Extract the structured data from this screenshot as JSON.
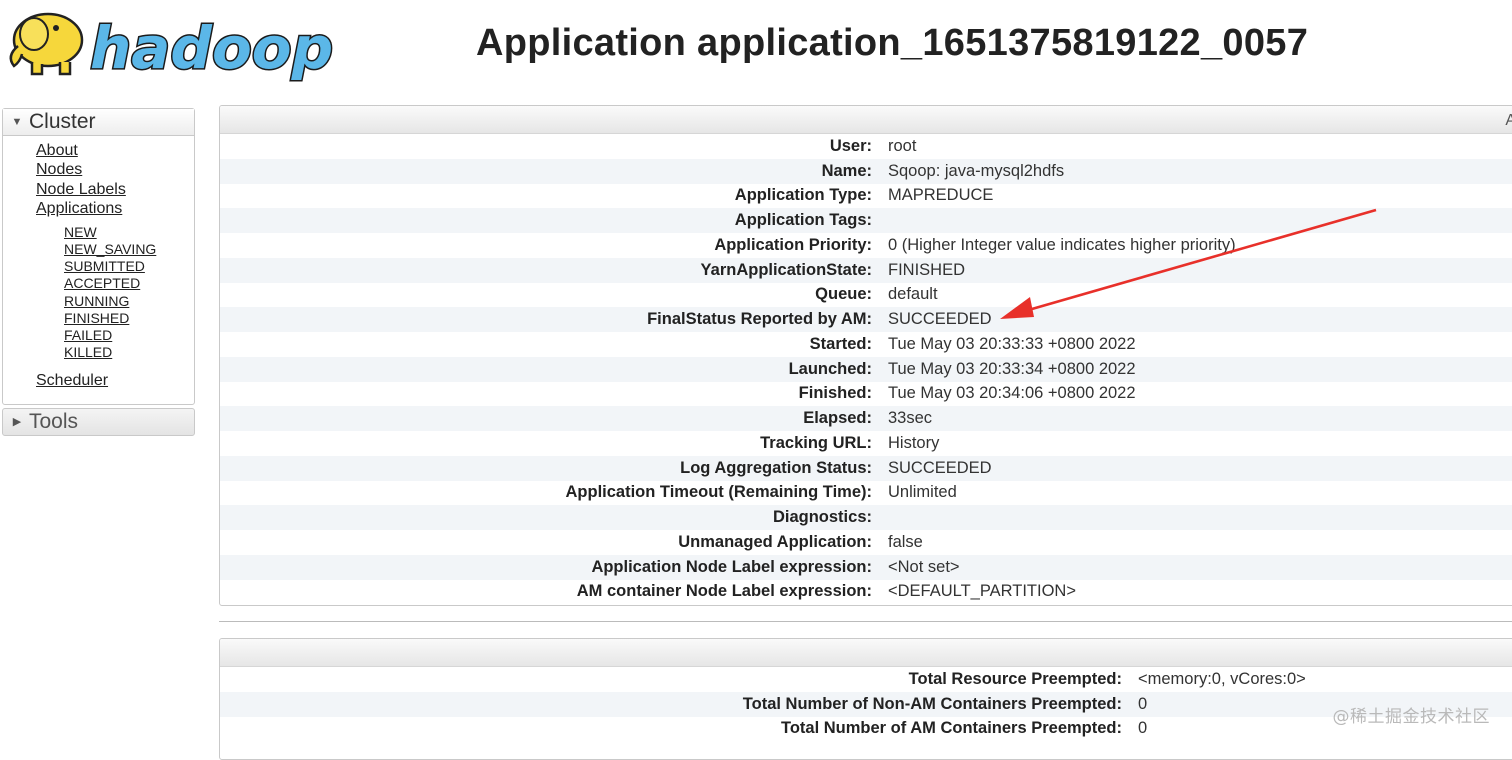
{
  "header": {
    "logo_text": "hadoop",
    "title": "Application application_1651375819122_0057"
  },
  "sidebar": {
    "cluster_label": "Cluster",
    "tools_label": "Tools",
    "links": [
      "About",
      "Nodes",
      "Node Labels",
      "Applications"
    ],
    "app_states": [
      "NEW",
      "NEW_SAVING",
      "SUBMITTED",
      "ACCEPTED",
      "RUNNING",
      "FINISHED",
      "FAILED",
      "KILLED"
    ],
    "scheduler_label": "Scheduler"
  },
  "overview": {
    "corner_letter": "A",
    "rows": [
      {
        "key": "User:",
        "value": "root",
        "link": true
      },
      {
        "key": "Name:",
        "value": "Sqoop: java-mysql2hdfs"
      },
      {
        "key": "Application Type:",
        "value": "MAPREDUCE"
      },
      {
        "key": "Application Tags:",
        "value": ""
      },
      {
        "key": "Application Priority:",
        "value": "0 (Higher Integer value indicates higher priority)"
      },
      {
        "key": "YarnApplicationState:",
        "value": "FINISHED"
      },
      {
        "key": "Queue:",
        "value": "default",
        "link": true
      },
      {
        "key": "FinalStatus Reported by AM:",
        "value": "SUCCEEDED"
      },
      {
        "key": "Started:",
        "value": "Tue May 03 20:33:33 +0800 2022"
      },
      {
        "key": "Launched:",
        "value": "Tue May 03 20:33:34 +0800 2022"
      },
      {
        "key": "Finished:",
        "value": "Tue May 03 20:34:06 +0800 2022"
      },
      {
        "key": "Elapsed:",
        "value": "33sec"
      },
      {
        "key": "Tracking URL:",
        "value": "History",
        "link": true
      },
      {
        "key": "Log Aggregation Status:",
        "value": "SUCCEEDED"
      },
      {
        "key": "Application Timeout (Remaining Time):",
        "value": "Unlimited"
      },
      {
        "key": "Diagnostics:",
        "value": ""
      },
      {
        "key": "Unmanaged Application:",
        "value": "false"
      },
      {
        "key": "Application Node Label expression:",
        "value": "<Not set>"
      },
      {
        "key": "AM container Node Label expression:",
        "value": "<DEFAULT_PARTITION>"
      }
    ]
  },
  "preemption": {
    "rows": [
      {
        "key": "Total Resource Preempted:",
        "value": "<memory:0, vCores:0>"
      },
      {
        "key": "Total Number of Non-AM Containers Preempted:",
        "value": "0"
      },
      {
        "key": "Total Number of AM Containers Preempted:",
        "value": "0"
      }
    ]
  },
  "annotation": {
    "arrow_color": "#e8302a"
  },
  "watermark": "@稀土掘金技术社区",
  "icons": {
    "expanded": "triangle-down-icon",
    "collapsed": "triangle-right-icon",
    "logo": "hadoop-elephant-logo"
  }
}
